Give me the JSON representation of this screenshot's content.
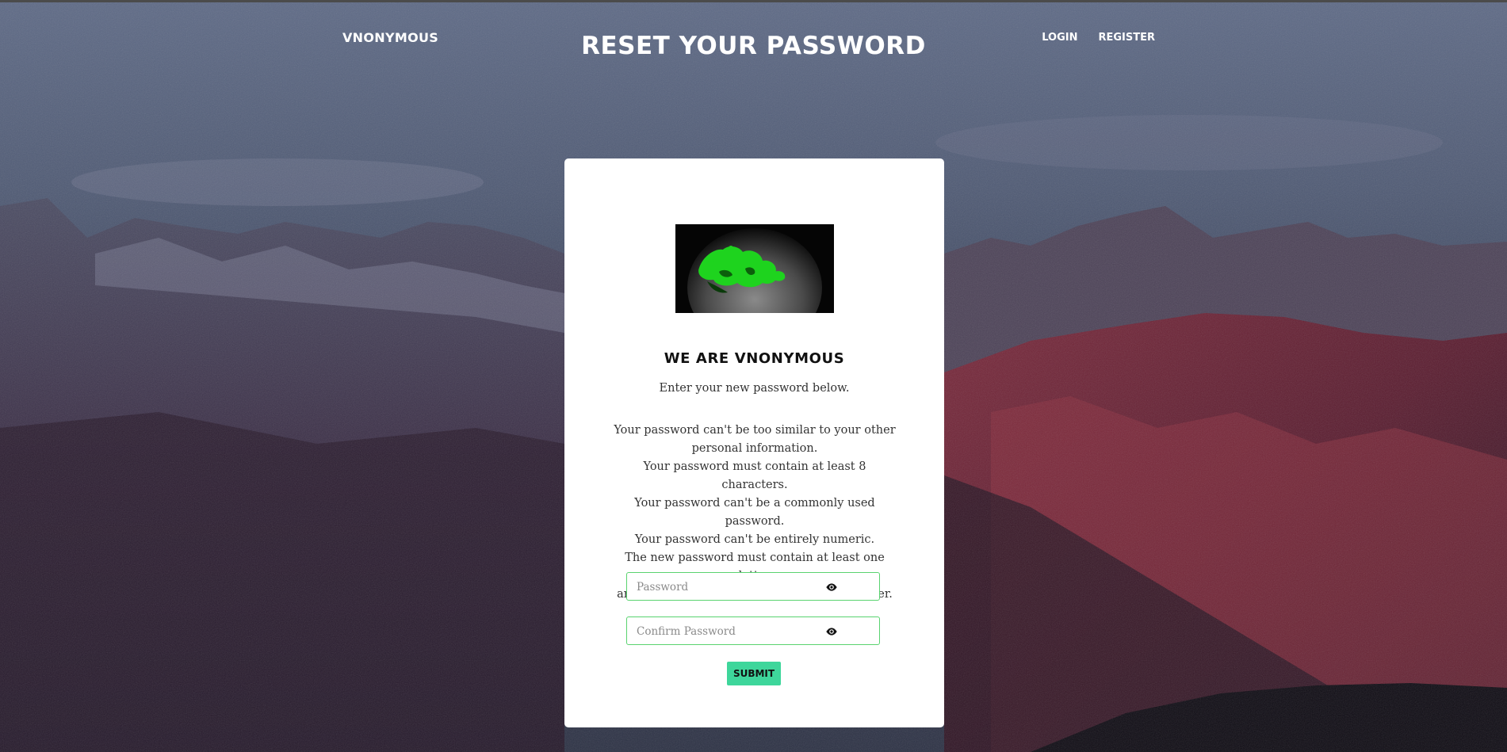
{
  "header": {
    "brand": "VNONYMOUS",
    "title": "RESET YOUR PASSWORD",
    "nav": [
      "LOGIN",
      "REGISTER"
    ]
  },
  "card": {
    "heading": "WE ARE VNONYMOUS",
    "subtext": "Enter your new password below.",
    "rules": [
      "Your password can't be too similar to your other",
      "personal information.",
      "Your password must contain at least 8 characters.",
      "Your password can't be a commonly used password.",
      "Your password can't be entirely numeric.",
      "The new password must contain at least one letter",
      "and at least one digit or punctuation character."
    ],
    "password_placeholder": "Password",
    "confirm_placeholder": "Confirm Password",
    "submit_label": "SUBMIT"
  },
  "icons": {
    "password_toggle": "eye-icon",
    "confirm_toggle": "eye-icon"
  },
  "colors": {
    "accent": "#3ed69b",
    "field_border": "#59d36f",
    "card_bg": "#ffffff",
    "text": "#111111"
  }
}
